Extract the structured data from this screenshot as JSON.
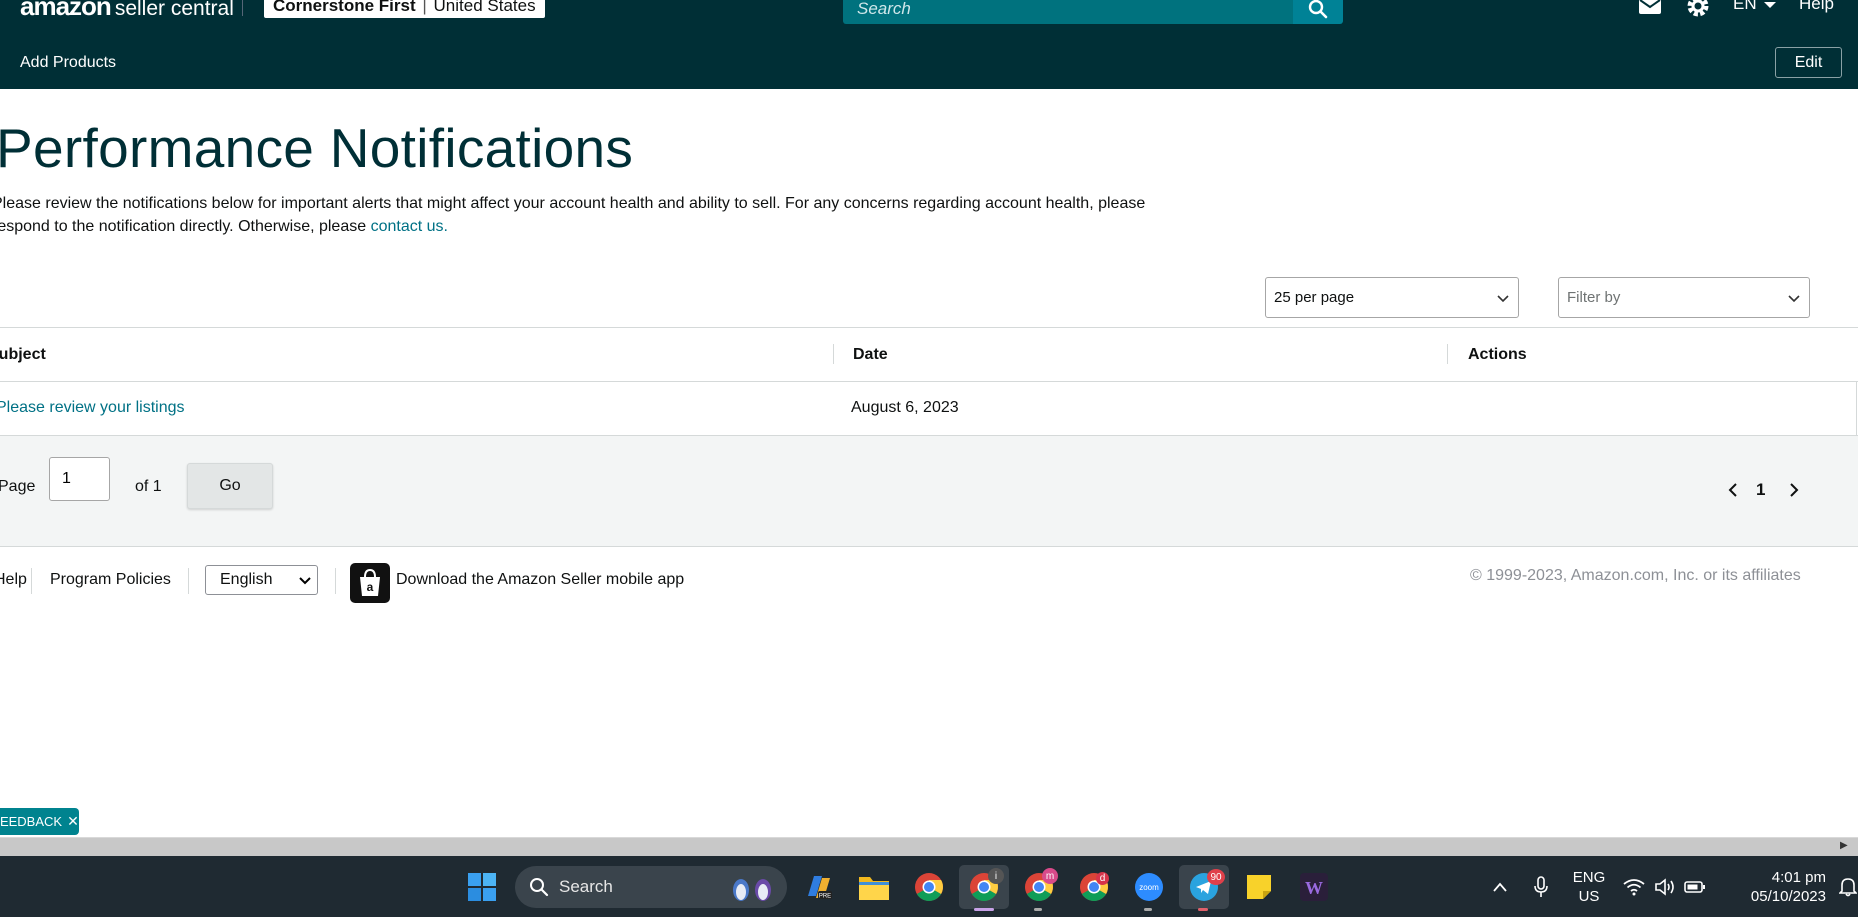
{
  "header": {
    "logo_brand": "amazon",
    "logo_product": "seller central",
    "account_name": "Cornerstone First",
    "account_sep": "|",
    "marketplace": "United States",
    "search_placeholder": "Search",
    "language": "EN",
    "help": "Help"
  },
  "subnav": {
    "add_products": "Add Products",
    "edit": "Edit"
  },
  "main": {
    "title": "Performance Notifications",
    "description": "Please review the notifications below for important alerts that might affect your account health and ability to sell. For any concerns regarding account health, please respond to the notification directly. Otherwise, please",
    "contact_link": "contact us.",
    "per_page": "25 per page",
    "filter_placeholder": "Filter by"
  },
  "table": {
    "columns": [
      "Subject",
      "Date",
      "Actions"
    ],
    "rows": [
      {
        "subject": "Please review your listings",
        "date": "August 6, 2023",
        "actions": ""
      }
    ]
  },
  "pagination": {
    "page_label": "Page",
    "page_value": "1",
    "of_label": "of 1",
    "go": "Go",
    "current": "1"
  },
  "footer": {
    "help": "Help",
    "program_policies": "Program Policies",
    "language": "English",
    "app_download": "Download the Amazon Seller mobile app",
    "copyright": "© 1999-2023, Amazon.com, Inc. or its affiliates"
  },
  "feedback": {
    "label": "FEEDBACK",
    "close": "✕"
  },
  "taskbar": {
    "search": "Search",
    "badges": {
      "chrome2": "i",
      "chrome3": "m",
      "chrome4": "d",
      "telegram": "90"
    },
    "zoom_label": "zoom",
    "lang_line1": "ENG",
    "lang_line2": "US",
    "time": "4:01 pm",
    "date": "05/10/2023"
  },
  "colors": {
    "header_bg": "#002f36",
    "link": "#007185",
    "search_bg": "#00727e"
  }
}
